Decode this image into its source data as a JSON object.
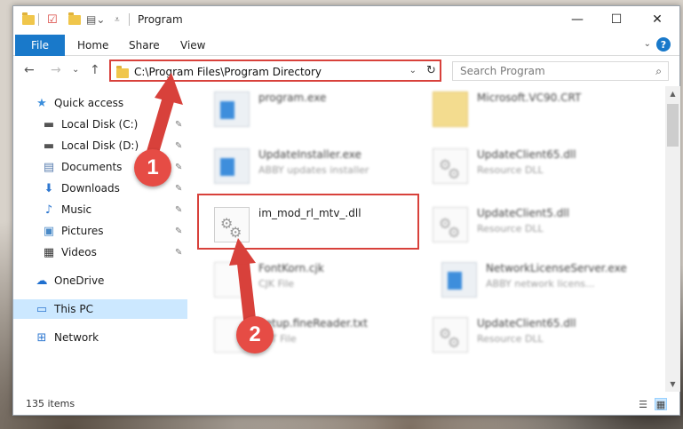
{
  "window": {
    "title": "Program",
    "minimize_glyph": "—",
    "maximize_glyph": "☐",
    "close_glyph": "✕"
  },
  "ribbon": {
    "file_tab": "File",
    "tabs": [
      "Home",
      "Share",
      "View"
    ],
    "help_glyph": "?",
    "collapse_glyph": "⌄"
  },
  "nav": {
    "back_glyph": "←",
    "forward_glyph": "→",
    "recent_glyph": "⌄",
    "up_glyph": "↑",
    "address_path": "C:\\Program Files\\Program Directory",
    "dropdown_glyph": "⌄",
    "refresh_glyph": "↻",
    "search_placeholder": "Search Program",
    "search_glyph": "⌕"
  },
  "sidebar": {
    "items": [
      {
        "label": "Quick access",
        "icon": "star-icon",
        "glyph": "★",
        "color": "#3b8edc",
        "pinned": false
      },
      {
        "label": "Local Disk (C:)",
        "icon": "drive-icon",
        "glyph": "▬",
        "color": "#555555",
        "pinned": true
      },
      {
        "label": "Local Disk (D:)",
        "icon": "drive-icon",
        "glyph": "▬",
        "color": "#555555",
        "pinned": true
      },
      {
        "label": "Documents",
        "icon": "documents-icon",
        "glyph": "▤",
        "color": "#5b7fb0",
        "pinned": true
      },
      {
        "label": "Downloads",
        "icon": "downloads-icon",
        "glyph": "⬇",
        "color": "#2f78d0",
        "pinned": true
      },
      {
        "label": "Music",
        "icon": "music-icon",
        "glyph": "♪",
        "color": "#2f78d0",
        "pinned": true
      },
      {
        "label": "Pictures",
        "icon": "pictures-icon",
        "glyph": "▣",
        "color": "#4a8ac7",
        "pinned": true
      },
      {
        "label": "Videos",
        "icon": "videos-icon",
        "glyph": "▦",
        "color": "#333333",
        "pinned": true
      },
      {
        "label": "OneDrive",
        "icon": "onedrive-icon",
        "glyph": "☁",
        "color": "#1f6fcf",
        "pinned": false
      },
      {
        "label": "This PC",
        "icon": "computer-icon",
        "glyph": "▭",
        "color": "#2f78d0",
        "pinned": false
      },
      {
        "label": "Network",
        "icon": "network-icon",
        "glyph": "⊞",
        "color": "#2f78d0",
        "pinned": false
      }
    ],
    "pin_glyph": "✎"
  },
  "files": [
    {
      "name": "program.exe",
      "desc": "",
      "type": "exe"
    },
    {
      "name": "Microsoft.VC90.CRT",
      "desc": "",
      "type": "folder"
    },
    {
      "name": "UpdateInstaller.exe",
      "desc": "ABBY updates installer",
      "type": "exe"
    },
    {
      "name": "UpdateClient65.dll",
      "desc": "Resource DLL",
      "type": "dll"
    },
    {
      "name": "im_mod_rl_mtv_.dll",
      "desc": "",
      "type": "dll"
    },
    {
      "name": "UpdateClient5.dll",
      "desc": "Resource DLL",
      "type": "dll"
    },
    {
      "name": "FontKorn.cjk",
      "desc": "CJK File",
      "type": "doc"
    },
    {
      "name": "NetworkLicenseServer.exe",
      "desc": "ABBY network licens...",
      "type": "exe"
    },
    {
      "name": "Setup.fineReader.txt",
      "desc": "TXT File",
      "type": "doc"
    },
    {
      "name": "UpdateClient65.dll",
      "desc": "Resource DLL",
      "type": "dll"
    }
  ],
  "status": {
    "count": "135 items"
  },
  "annotations": {
    "step1": "1",
    "step2": "2",
    "accent": "#d8413b"
  }
}
